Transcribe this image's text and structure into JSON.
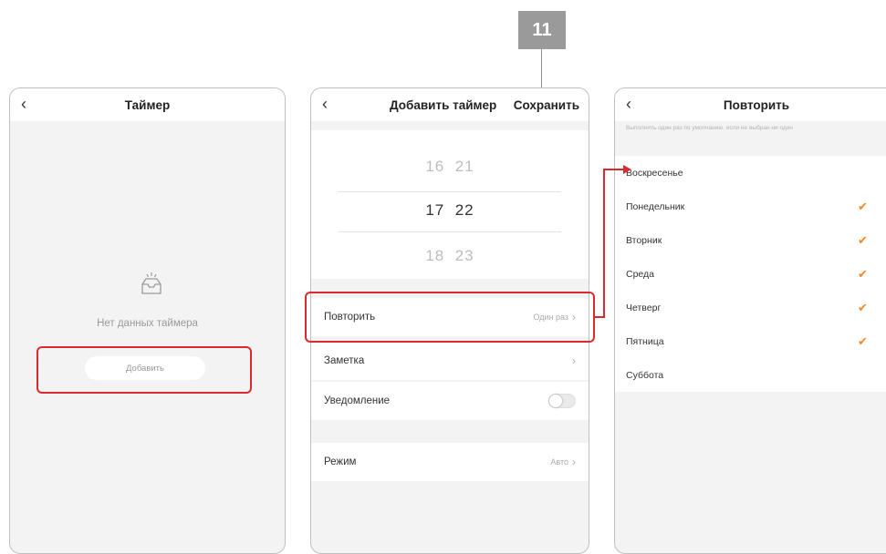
{
  "step": {
    "number": "11"
  },
  "timer_screen": {
    "back_icon": "chevron-left-icon",
    "title": "Таймер",
    "empty_icon": "empty-inbox-icon",
    "empty_text": "Нет данных таймера",
    "add_label": "Добавить"
  },
  "add_timer_screen": {
    "back_icon": "chevron-left-icon",
    "title": "Добавить таймер",
    "save_label": "Сохранить",
    "picker": {
      "rows": [
        {
          "hour": "16",
          "minute": "21",
          "selected": false
        },
        {
          "hour": "17",
          "minute": "22",
          "selected": true
        },
        {
          "hour": "18",
          "minute": "23",
          "selected": false
        }
      ]
    },
    "settings": [
      {
        "label": "Повторить",
        "value": "Один раз",
        "chevron": "›"
      },
      {
        "label": "Заметка",
        "value": "",
        "chevron": "›"
      },
      {
        "label": "Уведомление",
        "toggle": false
      },
      {
        "label": "Режим",
        "value": "Авто",
        "chevron": "›"
      }
    ]
  },
  "repeat_screen": {
    "back_icon": "chevron-left-icon",
    "title": "Повторить",
    "hint": "Выполнить один раз по умолчанию, если не выбран ни один",
    "check_icon": "checkmark-icon",
    "check_color": "#f08a2a",
    "days": [
      {
        "label": "Воскресенье",
        "checked": false
      },
      {
        "label": "Понедельник",
        "checked": true
      },
      {
        "label": "Вторник",
        "checked": true
      },
      {
        "label": "Среда",
        "checked": true
      },
      {
        "label": "Четверг",
        "checked": true
      },
      {
        "label": "Пятница",
        "checked": true
      },
      {
        "label": "Суббота",
        "checked": false
      }
    ]
  },
  "highlight_color": "#d92b2b"
}
